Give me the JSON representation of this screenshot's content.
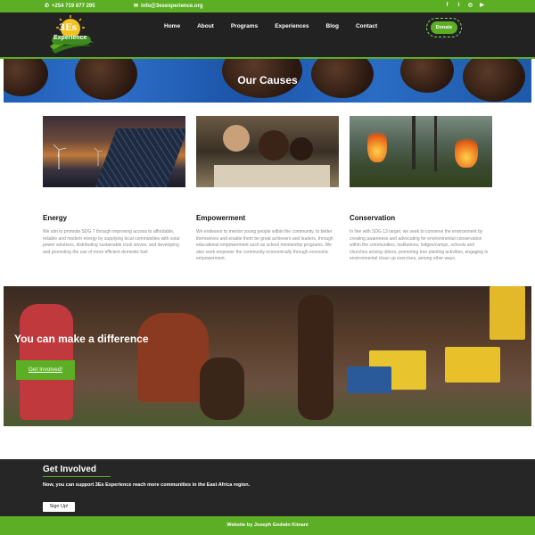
{
  "topbar": {
    "phone": "+254 719 877 295",
    "email": "info@3esexperience.org",
    "socials": [
      "facebook-icon",
      "twitter-icon",
      "instagram-icon",
      "youtube-icon"
    ]
  },
  "brand": {
    "logo_text": "3Es",
    "logo_sub": "Experience",
    "accent": "#5cae24"
  },
  "nav": {
    "items": [
      "Home",
      "About",
      "Programs",
      "Experiences",
      "Blog",
      "Contact"
    ],
    "donate": "Donate"
  },
  "hero": {
    "title": "Our Causes"
  },
  "causes": [
    {
      "title": "Energy",
      "text": "We aim to promote SDG 7 through improving access to affordable, reliable and modern energy by supplying local communities with solar power solutions, distributing sustainable cook stoves, and developing and promoting the use of more efficient domestic fuel."
    },
    {
      "title": "Empowerment",
      "text": "We endeavor to mentor young people within the community, to better themselves and enable them be great achievers and leaders, through educational empowerment such as school mentorship programs. We also seek empower the community economically through economic empowerment."
    },
    {
      "title": "Conservation",
      "text": "In line with SDG 13 target, we seek to conserve the environment by creating awareness and advocating for environmental conservation within the communities, institutions, lodges/camps, schools and churches among others, promoting tree planting activities, engaging in environmental clean up exercises, among other ways."
    }
  ],
  "difference": {
    "title": "You can make a difference",
    "button": "Get Involved!"
  },
  "involved": {
    "title": "Get Involved",
    "text": "Now, you can support 3Es Experience reach more communities in the East Africa region.",
    "button": "Sign Up!"
  },
  "footer": {
    "credit": "Website by Joseph Godwin Kimani"
  }
}
